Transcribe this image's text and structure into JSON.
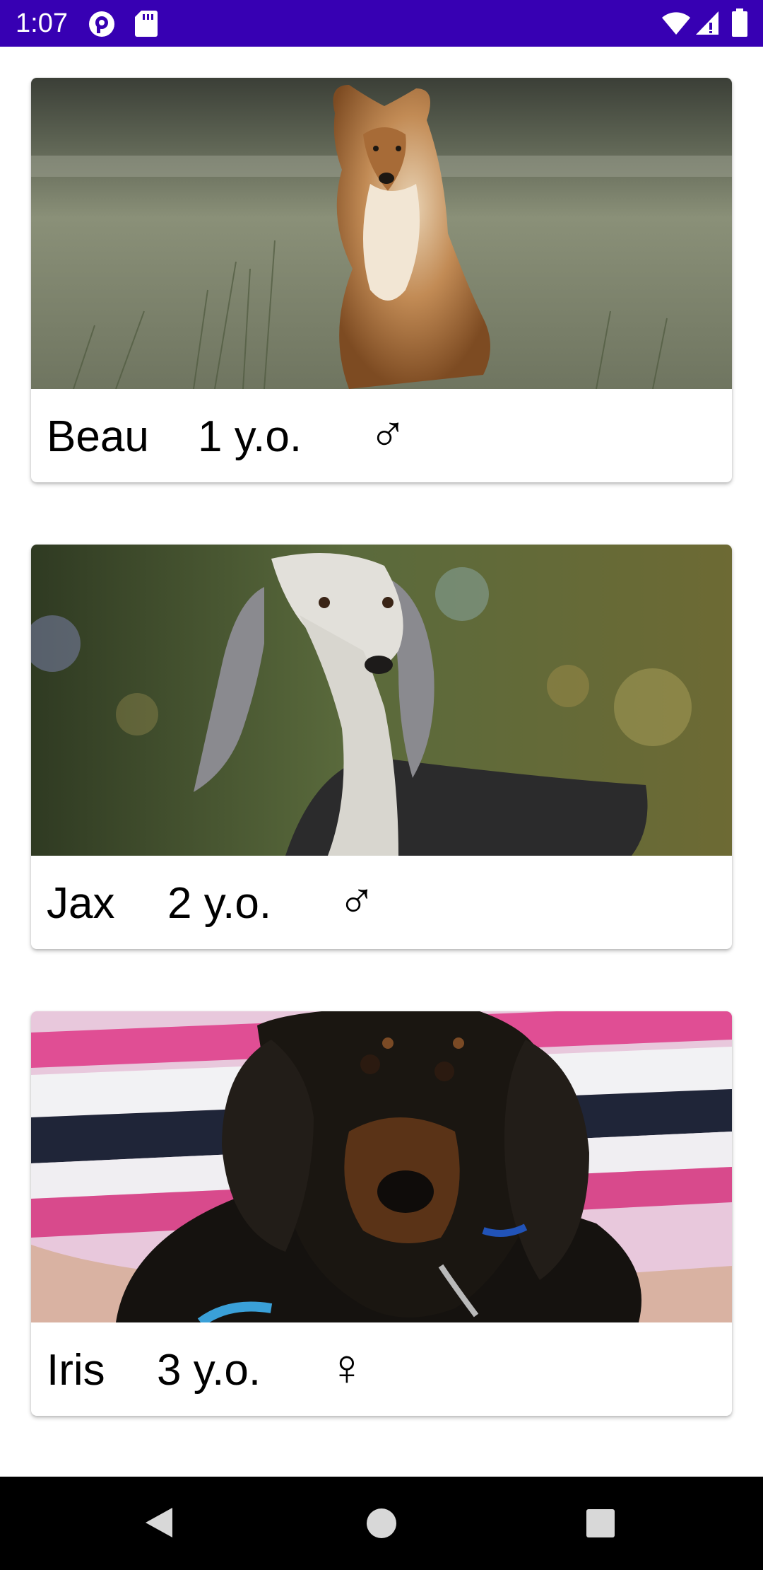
{
  "status_bar": {
    "time": "1:07",
    "icons": [
      "pocket-casts-icon",
      "sd-card-icon",
      "wifi-icon",
      "cellular-signal-icon",
      "battery-icon"
    ],
    "background": "#3700b3"
  },
  "pets": [
    {
      "name": "Beau",
      "age": "1 y.o.",
      "sex_symbol": "♂",
      "photo": "collie-photo"
    },
    {
      "name": "Jax",
      "age": "2 y.o.",
      "sex_symbol": "♂",
      "photo": "saluki-photo"
    },
    {
      "name": "Iris",
      "age": "3 y.o.",
      "sex_symbol": "♀",
      "photo": "dachshund-photo"
    }
  ],
  "nav_bar": {
    "buttons": [
      "back-icon",
      "home-icon",
      "recents-icon"
    ]
  }
}
